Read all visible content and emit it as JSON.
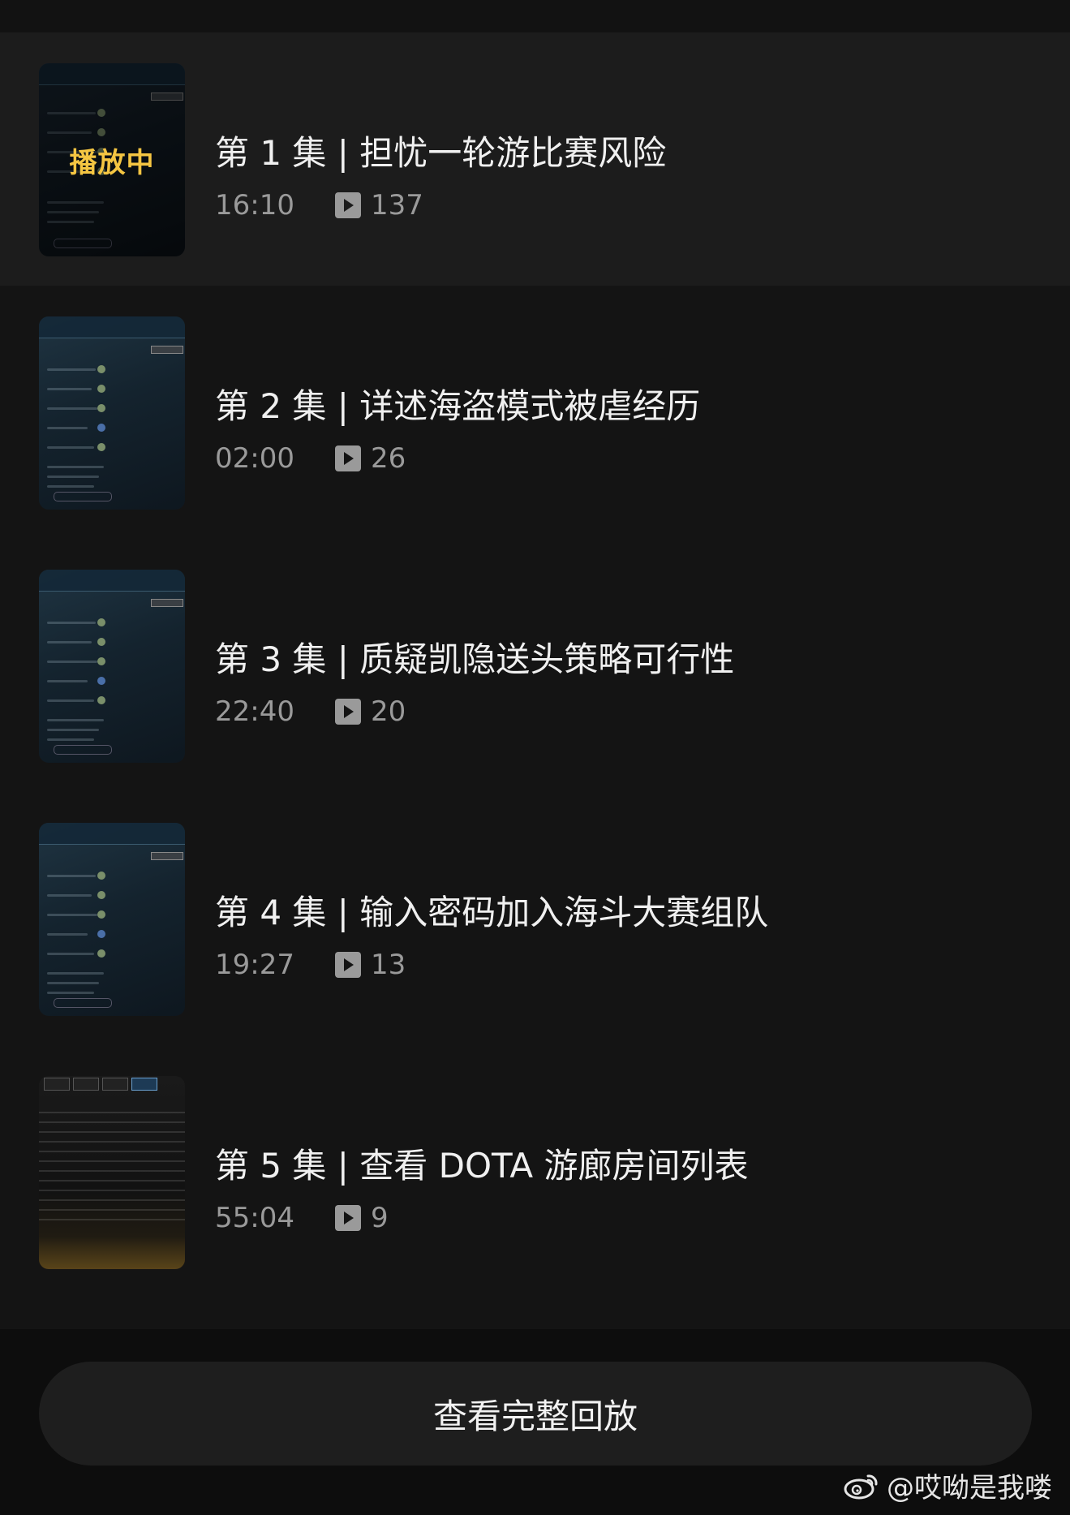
{
  "episodes": [
    {
      "title": "第 1 集 | 担忧一轮游比赛风险",
      "duration": "16:10",
      "plays": "137",
      "status": "播放中",
      "thumb": "lobby"
    },
    {
      "title": "第 2 集 | 详述海盗模式被虐经历",
      "duration": "02:00",
      "plays": "26",
      "thumb": "lobby"
    },
    {
      "title": "第 3 集 | 质疑凯隐送头策略可行性",
      "duration": "22:40",
      "plays": "20",
      "thumb": "lobby"
    },
    {
      "title": "第 4 集 | 输入密码加入海斗大赛组队",
      "duration": "19:27",
      "plays": "13",
      "thumb": "lobby"
    },
    {
      "title": "第 5 集 | 查看 DOTA 游廊房间列表",
      "duration": "55:04",
      "plays": "9",
      "thumb": "room-list"
    }
  ],
  "footer": {
    "full_replay_label": "查看完整回放"
  },
  "watermark": {
    "text": "@哎呦是我喽",
    "icon": "weibo-icon"
  },
  "icons": {
    "play_count": "play-icon"
  }
}
